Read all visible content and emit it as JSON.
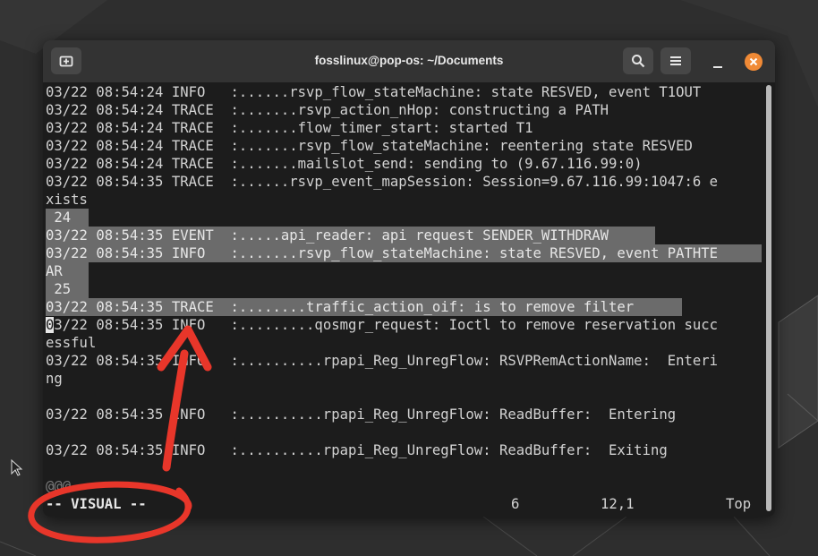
{
  "window": {
    "title": "fosslinux@pop-os: ~/Documents"
  },
  "terminal": {
    "lines": [
      "03/22 08:54:24 INFO   :......rsvp_flow_stateMachine: state RESVED, event T1OUT",
      "03/22 08:54:24 TRACE  :.......rsvp_action_nHop: constructing a PATH",
      "03/22 08:54:24 TRACE  :.......flow_timer_start: started T1",
      "03/22 08:54:24 TRACE  :.......rsvp_flow_stateMachine: reentering state RESVED",
      "03/22 08:54:24 TRACE  :.......mailslot_send: sending to (9.67.116.99:0)",
      "03/22 08:54:35 TRACE  :......rsvp_event_mapSession: Session=9.67.116.99:1047:6 e",
      "xists",
      " 24",
      "03/22 08:54:35 EVENT  :.....api_reader: api request SENDER_WITHDRAW",
      "03/22 08:54:35 INFO   :.......rsvp_flow_stateMachine: state RESVED, event PATHTE",
      "AR",
      " 25",
      "03/22 08:54:35 TRACE  :........traffic_action_oif: is to remove filter",
      "03/22 08:54:35 INFO   :.........qosmgr_request: Ioctl to remove reservation succ",
      "essful",
      "03/22 08:54:35 INFO   :..........rpapi_Reg_UnregFlow: RSVPRemActionName:  Enteri",
      "ng",
      "",
      "03/22 08:54:35 INFO   :..........rpapi_Reg_UnregFlow: ReadBuffer:  Entering",
      "",
      "03/22 08:54:35 INFO   :..........rpapi_Reg_UnregFlow: ReadBuffer:  Exiting",
      "",
      "@@@"
    ],
    "cursor_char": "0",
    "cursor_rest": "3/22 08:54:35 INFO   :.........qosmgr_request: Ioctl to remove reservation succ",
    "status": {
      "mode": "-- VISUAL --",
      "selection_count": "6",
      "position": "12,1",
      "scroll": "Top"
    }
  },
  "icons": {
    "new_tab": "new-tab-icon",
    "search": "search-icon",
    "menu": "hamburger-menu-icon",
    "minimize": "minimize-icon",
    "close": "close-icon"
  },
  "colors": {
    "close_button": "#f08a36",
    "annotation": "#e8362a",
    "selection": "#6b6b6b"
  }
}
